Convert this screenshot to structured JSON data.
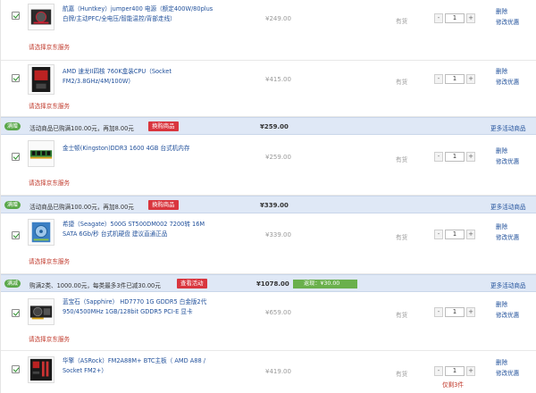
{
  "items": [
    {
      "name": "航嘉（Huntkey）jumper400 电源（额定400W/80plus白牌/主动PFC/全电压/智能温控/背部走线）",
      "service": "请选择京东服务",
      "price": "¥249.00",
      "stock": "有货",
      "qty": "1",
      "delete": "删除",
      "edit": "修改优惠",
      "thumb_icon": "power-supply-icon"
    },
    {
      "name": "AMD 速龙II四核 760K盒装CPU（Socket FM2/3.8GHz/4M/100W）",
      "service": "请选择京东服务",
      "price": "¥415.00",
      "stock": "有货",
      "qty": "1",
      "delete": "删除",
      "edit": "修改优惠",
      "thumb_icon": "cpu-box-icon"
    },
    {
      "name": "金士顿(Kingston)DDR3 1600 4GB 台式机内存",
      "service": "请选择京东服务",
      "price": "¥259.00",
      "stock": "有货",
      "qty": "1",
      "delete": "删除",
      "edit": "修改优惠",
      "thumb_icon": "memory-stick-icon"
    },
    {
      "name": "希捷（Seagate）500G ST500DM002 7200转 16M SATA 6Gb/秒 台式机硬盘 建议直通正品",
      "service": "请选择京东服务",
      "price": "¥339.00",
      "stock": "有货",
      "qty": "1",
      "delete": "删除",
      "edit": "修改优惠",
      "thumb_icon": "hard-drive-icon"
    },
    {
      "name": "蓝宝石（Sapphire） HD7770 1G GDDR5 白金版2代 950/4500MHz 1GB/128bit GDDR5 PCI-E 显卡",
      "service": "请选择京东服务",
      "price": "¥659.00",
      "stock": "有货",
      "qty": "1",
      "delete": "删除",
      "edit": "修改优惠",
      "thumb_icon": "graphics-card-icon"
    },
    {
      "name": "华擎（ASRock）FM2A88M+ BTC主板（ AMD A88 / Socket FM2+）",
      "service": "",
      "price": "¥419.00",
      "stock": "有货",
      "qty": "1",
      "delete": "删除",
      "edit": "修改优惠",
      "thumb_icon": "motherboard-icon"
    }
  ],
  "promos": [
    {
      "tag": "满赠",
      "text": "活动商品已购满100.00元，再加8.00元",
      "button": "换购商品",
      "total": "¥259.00",
      "more": "更多活动商品"
    },
    {
      "tag": "满赠",
      "text": "活动商品已购满100.00元，再加8.00元",
      "button": "换购商品",
      "total": "¥339.00",
      "more": "更多活动商品"
    },
    {
      "tag": "满减",
      "text": "购满2类、1000.00元，每类最多3件已减30.00元",
      "button": "查看活动",
      "total": "¥1078.00",
      "discount": "返现：¥30.00",
      "more": "更多活动商品"
    }
  ],
  "limit_note": "仅剩3件",
  "colors": {
    "link": "#1f4f9a",
    "red": "#c0392b",
    "promo_bg": "#dfe8f6",
    "tag_green": "#5aa84a",
    "discount_green": "#6ab04c"
  }
}
